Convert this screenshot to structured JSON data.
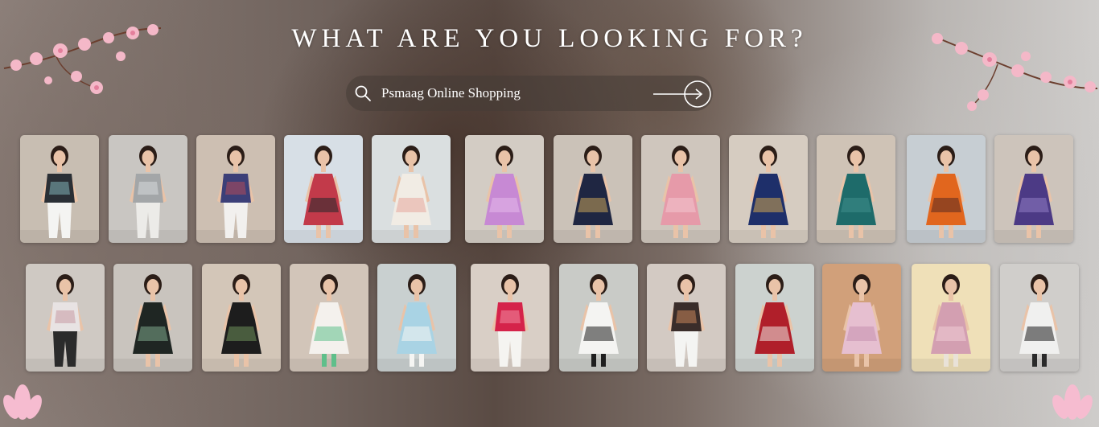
{
  "hero": {
    "title": "WHAT ARE YOU LOOKING FOR?"
  },
  "search": {
    "value": "Psmaag Online Shopping",
    "icon": "search-icon",
    "submit_icon": "arrow-right-circle-icon"
  },
  "colors": {
    "text": "#ffffff",
    "blossom": "#f4b8c8"
  },
  "products_row1": [
    {
      "name": "product-floral-black-top",
      "bg": "#c8beb2",
      "top": "#2a2f35",
      "accent": "#7fb0b5",
      "bottom": "#f4f4f2",
      "dress": false
    },
    {
      "name": "product-grey-ruffle-top",
      "bg": "#c9c6c2",
      "top": "#a3a6a8",
      "accent": "#d7d9da",
      "bottom": "#ecebe8",
      "dress": false
    },
    {
      "name": "product-checked-bell-sleeve-top",
      "bg": "#cdbfb2",
      "top": "#3c3f78",
      "accent": "#b04a5a",
      "bottom": "#f2f0ee",
      "dress": false
    },
    {
      "name": "product-floral-red-dress",
      "bg": "#d7dfe6",
      "top": "#c23a4a",
      "accent": "#23282c",
      "bottom": "#c23a4a",
      "dress": true
    },
    {
      "name": "product-white-anarkali",
      "bg": "#dadfe0",
      "top": "#f1ece4",
      "accent": "#e6a89d",
      "bottom": "#f1ece4",
      "dress": true
    },
    {
      "name": "product-lilac-anarkali",
      "bg": "#d3ccc4",
      "top": "#c789d4",
      "accent": "#e3b8ea",
      "bottom": "#c789d4",
      "dress": true
    },
    {
      "name": "product-navy-gold-anarkali",
      "bg": "#cbc2b8",
      "top": "#1f2642",
      "accent": "#c7a35a",
      "bottom": "#1f2642",
      "dress": true
    },
    {
      "name": "product-pink-block-print-kurta",
      "bg": "#cfc6bd",
      "top": "#e69aa9",
      "accent": "#f3c6cf",
      "bottom": "#e69aa9",
      "dress": true
    },
    {
      "name": "product-blue-ethnic-gown",
      "bg": "#d6ccc1",
      "top": "#1e2f6a",
      "accent": "#d1a64f",
      "bottom": "#1e2f6a",
      "dress": true
    },
    {
      "name": "product-teal-anarkali",
      "bg": "#cfc3b6",
      "top": "#1e6b6a",
      "accent": "#3f8e8a",
      "bottom": "#1e6b6a",
      "dress": true
    },
    {
      "name": "product-orange-straight-kurta",
      "bg": "#c7ced3",
      "top": "#e1661e",
      "accent": "#5a2a22",
      "bottom": "#e1661e",
      "dress": true
    },
    {
      "name": "product-purple-anarkali",
      "bg": "#cdc4bb",
      "top": "#4c3a85",
      "accent": "#8f7bc3",
      "bottom": "#4c3a85",
      "dress": true
    }
  ],
  "products_row2": [
    {
      "name": "product-white-long-kurta",
      "bg": "#cfc9c3",
      "top": "#e8e3e3",
      "accent": "#c79aa4",
      "bottom": "#2b2b2b",
      "dress": false
    },
    {
      "name": "product-black-floral-dress",
      "bg": "#c9c4be",
      "top": "#1f2623",
      "accent": "#7ea88c",
      "bottom": "#1f2623",
      "dress": true
    },
    {
      "name": "product-black-printed-kurta",
      "bg": "#d3c6b8",
      "top": "#1d1d1d",
      "accent": "#6d8f5a",
      "bottom": "#1d1d1d",
      "dress": true
    },
    {
      "name": "product-green-tiered-skirt",
      "bg": "#d2c5b9",
      "top": "#f4f1ed",
      "accent": "#5fbf8a",
      "bottom": "#5fbf8a",
      "dress": true
    },
    {
      "name": "product-white-palazzo-set",
      "bg": "#c9d0d0",
      "top": "#a9d3e4",
      "accent": "#f5f5f3",
      "bottom": "#f5f5f3",
      "dress": true
    },
    {
      "name": "product-red-print-shirt",
      "bg": "#d9cfc6",
      "top": "#d5234a",
      "accent": "#f08aa0",
      "bottom": "#f5f4f1",
      "dress": false
    },
    {
      "name": "product-black-palazzo",
      "bg": "#c9cbc7",
      "top": "#f4f4f2",
      "accent": "#1f1f1f",
      "bottom": "#1f1f1f",
      "dress": true
    },
    {
      "name": "product-printed-crop-top",
      "bg": "#d3cac3",
      "top": "#3a2d2a",
      "accent": "#c7855a",
      "bottom": "#f4f4f2",
      "dress": false
    },
    {
      "name": "product-red-floral-dress",
      "bg": "#ccd2cf",
      "top": "#b01f2a",
      "accent": "#ece6e0",
      "bottom": "#b01f2a",
      "dress": true
    },
    {
      "name": "product-pink-flared-skirt",
      "bg": "#d1a07a",
      "top": "#e6bfd0",
      "accent": "#c58fae",
      "bottom": "#e6bfd0",
      "dress": true
    },
    {
      "name": "product-pink-checked-kurta",
      "bg": "#efe0b8",
      "top": "#d39fb1",
      "accent": "#f1ccd6",
      "bottom": "#e9e2d8",
      "dress": true
    },
    {
      "name": "product-black-white-kurta",
      "bg": "#d0cecb",
      "top": "#f0f0ef",
      "accent": "#1e1e1e",
      "bottom": "#2a2a2a",
      "dress": true
    }
  ]
}
